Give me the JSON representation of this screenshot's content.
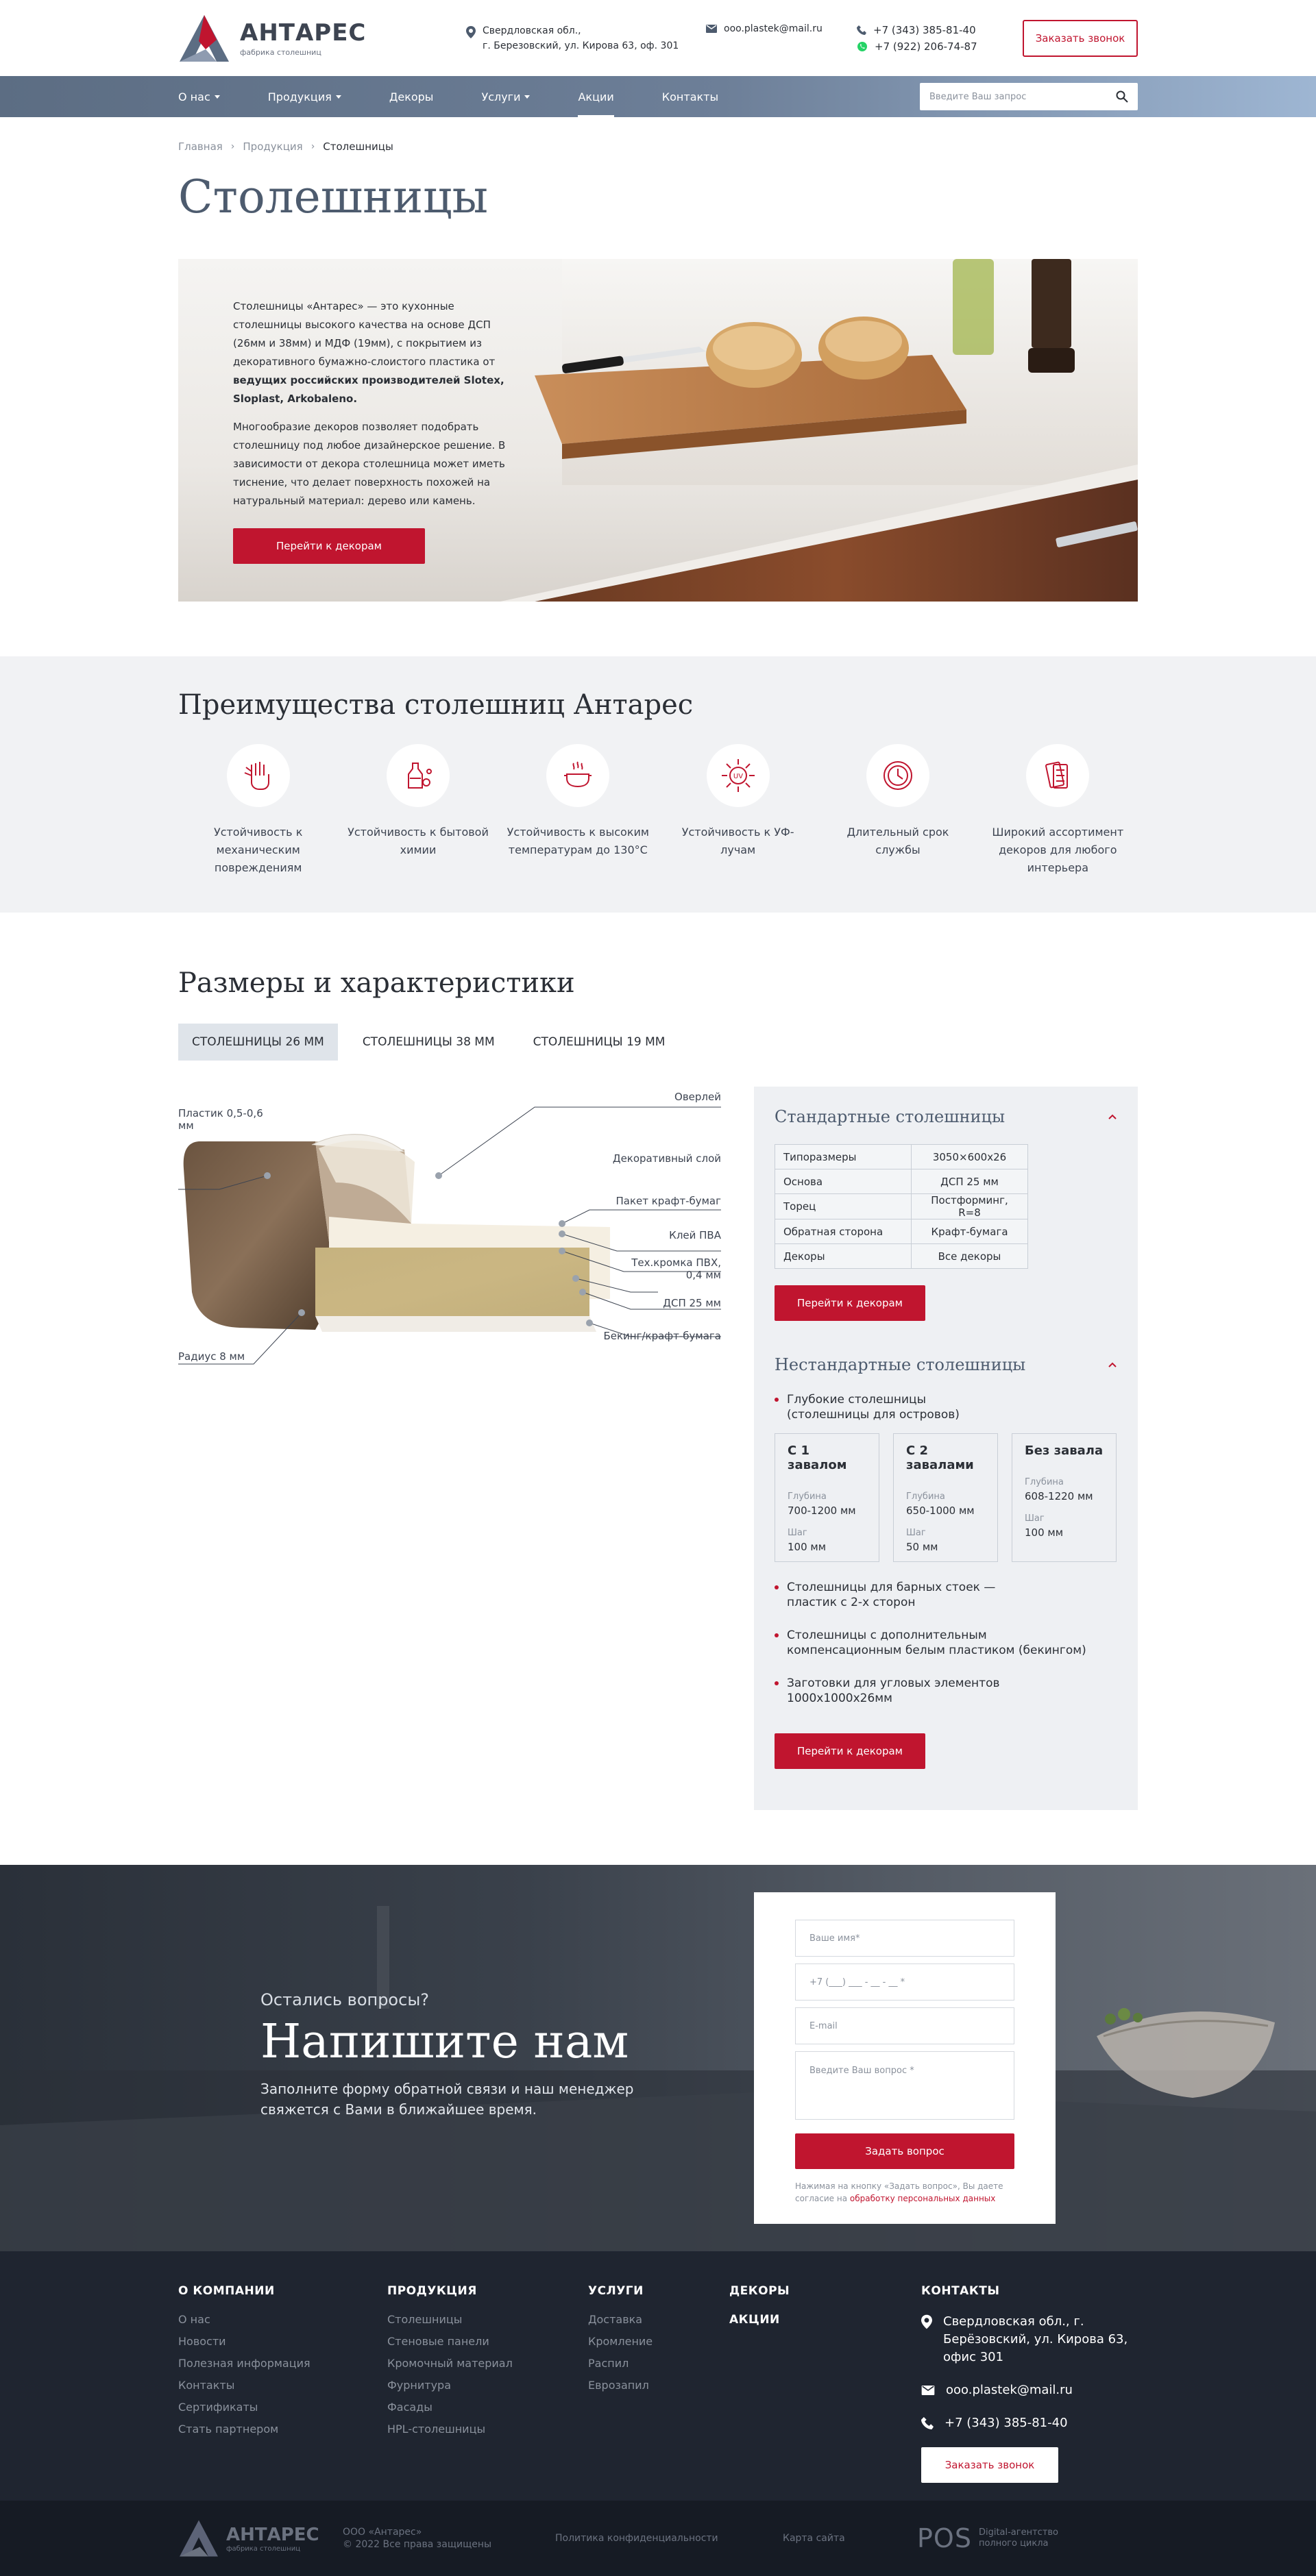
{
  "brand": {
    "name": "АНТАРЕС",
    "tagline": "фабрика столешниц"
  },
  "header": {
    "address_line1": "Свердловская обл.,",
    "address_line2": "г. Березовский, ул. Кирова 63, оф. 301",
    "email": "ooo.plastek@mail.ru",
    "phone1": "+7 (343) 385-81-40",
    "phone2": "+7 (922) 206-74-87",
    "call_button": "Заказать звонок"
  },
  "nav": {
    "items": [
      "О нас",
      "Продукция",
      "Декоры",
      "Услуги",
      "Акции",
      "Контакты"
    ],
    "search_placeholder": "Введите Ваш запрос"
  },
  "breadcrumb": [
    "Главная",
    "Продукция",
    "Столешницы"
  ],
  "page_title": "Столешницы",
  "hero": {
    "p1_a": "Столешницы «Антарес» — это кухонные столешницы высокого качества на основе ДСП (26мм и 38мм) и МДФ (19мм), с покрытием из декоративного бумажно-слоистого пластика от ",
    "p1_b": "ведущих российских производителей Slotex, Sloplast, Arkobaleno.",
    "p2": "Многообразие декоров позволяет подобрать столешницу под любое дизайнерское решение. В зависимости от декора столешница может иметь тиснение, что делает поверхность похожей на натуральный материал: дерево или камень.",
    "button": "Перейти к декорам"
  },
  "advantages": {
    "title": "Преимущества столешниц Антарес",
    "items": [
      {
        "label": "Устойчивость к механическим повреждениям",
        "icon": "hand-scratch-icon"
      },
      {
        "label": "Устойчивость к бытовой химии",
        "icon": "chemistry-icon"
      },
      {
        "label": "Устойчивость к высоким температурам до 130°С",
        "icon": "hot-pot-icon"
      },
      {
        "label": "Устойчивость к УФ-лучам",
        "icon": "uv-sun-icon"
      },
      {
        "label": "Длительный срок службы",
        "icon": "clock-icon"
      },
      {
        "label": "Широкий ассортимент декоров для любого интерьера",
        "icon": "swatches-icon"
      }
    ]
  },
  "sizes": {
    "title": "Размеры и характеристики",
    "tabs": [
      "СТОЛЕШНИЦЫ 26 ММ",
      "СТОЛЕШНИЦЫ 38 ММ",
      "СТОЛЕШНИЦЫ 19 ММ"
    ],
    "layers": {
      "plastic": "Пластик 0,5-0,6 мм",
      "radius": "Радиус 8 мм",
      "overlay": "Оверлей",
      "decor": "Декоративный слой",
      "kraft": "Пакет крафт-бумаг",
      "pva": "Клей ПВА",
      "edge_a": "Тех.кромка ПВХ,",
      "edge_b": "0,4 мм",
      "dsp": "ДСП 25 мм",
      "backing": "Бекинг/крафт-бумага"
    },
    "standard": {
      "title": "Стандартные столешницы",
      "rows": [
        [
          "Типоразмеры",
          "3050×600х26"
        ],
        [
          "Основа",
          "ДСП 25 мм"
        ],
        [
          "Торец",
          "Постформинг, R=8"
        ],
        [
          "Обратная сторона",
          "Крафт-бумага"
        ],
        [
          "Декоры",
          "Все декоры"
        ]
      ],
      "button": "Перейти к декорам"
    },
    "custom": {
      "title": "Нестандартные столешницы",
      "bullet1_a": "Глубокие столешницы",
      "bullet1_b": "(столешницы для островов)",
      "cards": [
        {
          "title": "С 1 завалом",
          "depth": "700-1200 мм",
          "step": "100 мм"
        },
        {
          "title": "С 2 завалами",
          "depth": "650-1000 мм",
          "step": "50 мм"
        },
        {
          "title": "Без завала",
          "depth": "608-1220 мм",
          "step": "100 мм"
        }
      ],
      "depth_label": "Глубина",
      "step_label": "Шаг",
      "bullet2_a": "Столешницы для барных стоек —",
      "bullet2_b": "пластик с 2-х сторон",
      "bullet3_a": "Столешницы с дополнительным",
      "bullet3_b": "компенсационным белым пластиком (бекингом)",
      "bullet4_a": "Заготовки для угловых элементов",
      "bullet4_b": "1000x1000x26мм",
      "button": "Перейти к декорам"
    }
  },
  "contact": {
    "subtitle": "Остались вопросы?",
    "title": "Напишите нам",
    "desc_a": "Заполните форму обратной связи и наш менеджер",
    "desc_b": "свяжется с Вами в ближайшее время.",
    "name_placeholder": "Ваше имя*",
    "phone_placeholder": "+7 (___) ___ - __ - __ *",
    "email_placeholder": "E-mail",
    "question_placeholder": "Введите Ваш вопрос *",
    "button": "Задать вопрос",
    "consent_a": "Нажимая на кнопку «Задать вопрос», Вы даете согласие на ",
    "consent_link": "обработку персональных данных"
  },
  "footer": {
    "company": {
      "title": "О КОМПАНИИ",
      "links": [
        "О нас",
        "Новости",
        "Полезная информация",
        "Контакты",
        "Сертификаты",
        "Стать партнером"
      ]
    },
    "products": {
      "title": "ПРОДУКЦИЯ",
      "links": [
        "Столешницы",
        "Стеновые панели",
        "Кромочный материал",
        "Фурнитура",
        "Фасады",
        "HPL-столешницы"
      ]
    },
    "services": {
      "title": "УСЛУГИ",
      "links": [
        "Доставка",
        "Кромление",
        "Распил",
        "Еврозапил"
      ]
    },
    "decors": "ДЕКОРЫ",
    "promo": "АКЦИИ",
    "contacts": {
      "title": "КОНТАКТЫ",
      "address": "Свердловская обл., г. Берёзовский, ул. Кирова 63, офис 301",
      "email": "ooo.plastek@mail.ru",
      "phone": "+7 (343) 385-81-40",
      "button": "Заказать звонок"
    }
  },
  "bottom": {
    "copyright1": "ООО «Антарес»",
    "copyright2": "© 2022 Все права защищены",
    "privacy": "Политика конфиденциальности",
    "sitemap": "Карта сайта",
    "agency_logo": "POS",
    "agency1": "Digital-агентство",
    "agency2": "полного цикла"
  },
  "colors": {
    "accent": "#c0152f",
    "nav": "#6d7f98",
    "title": "#4d5b6e",
    "footer": "#1f2530"
  }
}
